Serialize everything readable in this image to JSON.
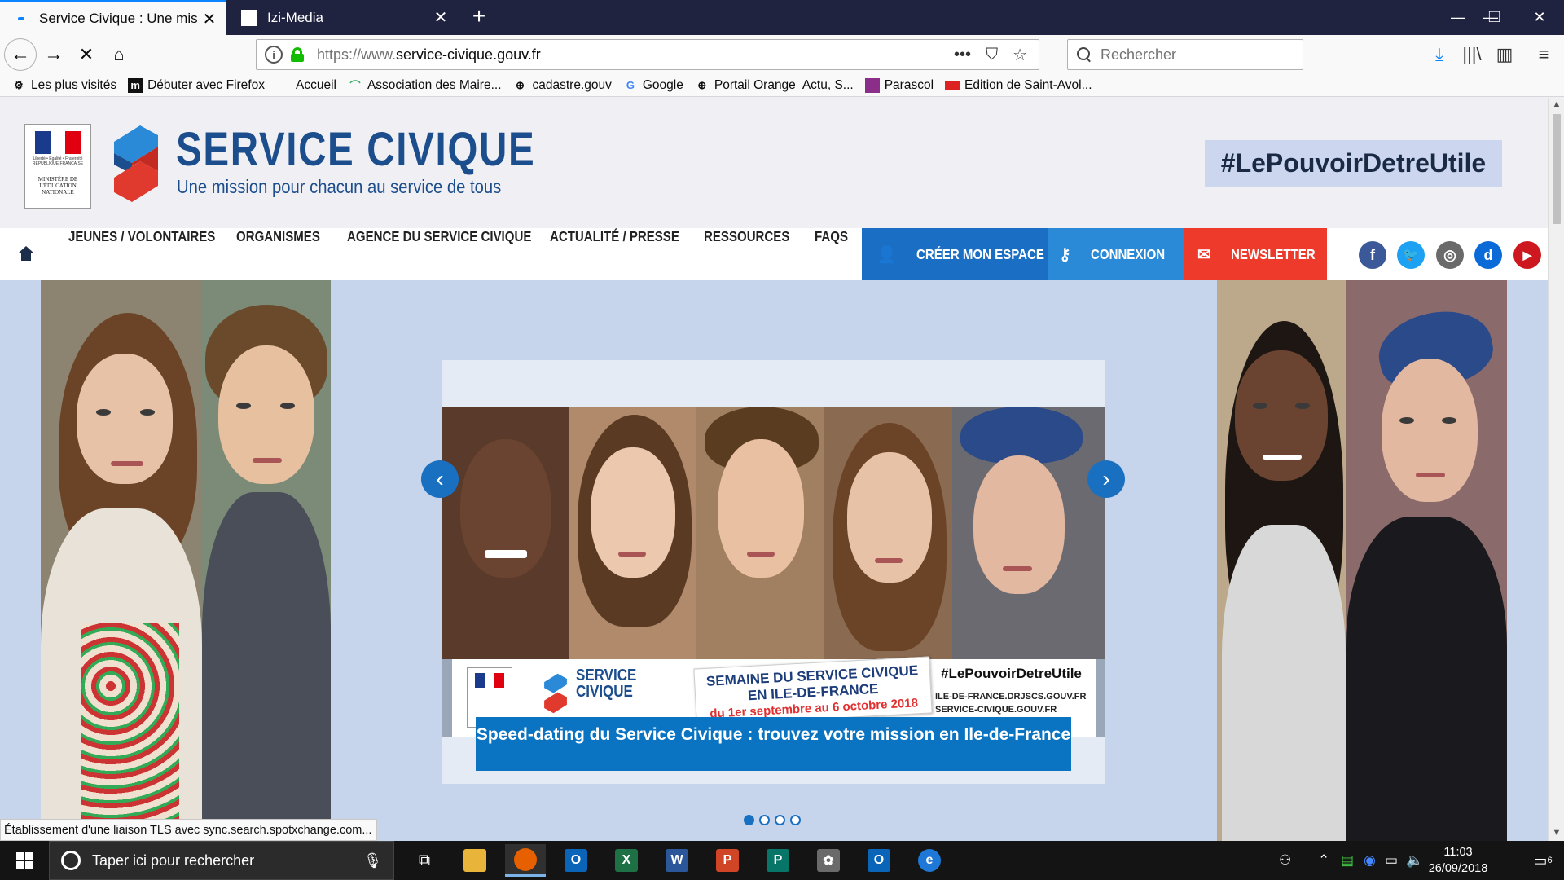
{
  "browser": {
    "tabs": [
      {
        "title": "Service Civique : Une mission p",
        "close": "✕"
      },
      {
        "title": "Izi-Media",
        "close": "✕"
      }
    ],
    "new_tab": "+",
    "window_controls": {
      "minimize": "—",
      "restore": "❐",
      "close": "✕"
    },
    "url": {
      "prefix": "https://www.",
      "domain": "service-civique.gouv.fr"
    },
    "url_actions": {
      "more": "•••",
      "pocket": "⛉",
      "bookmark": "☆"
    },
    "search_placeholder": "Rechercher",
    "bookmarks": [
      {
        "label": "Les plus visités",
        "icon": "gear-icon"
      },
      {
        "label": "Débuter avec Firefox",
        "icon": "m-icon"
      },
      {
        "label": "Accueil",
        "icon": "blank-icon"
      },
      {
        "label": "Association des Maire...",
        "icon": "hat-icon"
      },
      {
        "label": "cadastre.gouv",
        "icon": "globe-icon"
      },
      {
        "label": "Google",
        "icon": "google-icon"
      },
      {
        "label": "Portail Orange",
        "icon": "globe-icon"
      },
      {
        "label": "Actu, S...",
        "icon": "none"
      },
      {
        "label": "Parascol",
        "icon": "parascol-icon"
      },
      {
        "label": "Edition de Saint-Avol...",
        "icon": "edition-icon"
      }
    ]
  },
  "page": {
    "ministere": "MINISTÈRE DE L'ÉDUCATION NATIONALE",
    "republique_motto": "Liberté • Égalité • Fraternité RÉPUBLIQUE FRANÇAISE",
    "title": "SERVICE CIVIQUE",
    "subtitle": "Une mission pour chacun au service de tous",
    "hashtag": "#LePouvoirDetreUtile",
    "menu": [
      "JEUNES / VOLONTAIRES",
      "ORGANISMES",
      "AGENCE DU SERVICE CIVIQUE",
      "ACTUALITÉ / PRESSE",
      "RESSOURCES",
      "FAQS"
    ],
    "buttons": {
      "espace": "CRÉER MON ESPACE",
      "connexion": "CONNEXION",
      "newsletter": "NEWSLETTER"
    },
    "social": [
      {
        "letter": "f",
        "color": "#3b5998",
        "icon": "facebook-icon"
      },
      {
        "letter": "🐦",
        "color": "#1da1f2",
        "icon": "twitter-icon"
      },
      {
        "letter": "◎",
        "color": "#6a6a6a",
        "icon": "instagram-icon"
      },
      {
        "letter": "d",
        "color": "#0a6ad8",
        "icon": "dailymotion-icon"
      },
      {
        "letter": "▶",
        "color": "#cc181e",
        "icon": "youtube-icon"
      }
    ],
    "slider": {
      "banner_title_1": "SEMAINE DU SERVICE CIVIQUE",
      "banner_title_2": "EN ILE-DE-FRANCE",
      "banner_dates": "du 1er septembre au 6 octobre 2018",
      "banner_hashtag": "#LePouvoirDetreUtile",
      "banner_site_1": "ILE-DE-FRANCE.DRJSCS.GOUV.FR",
      "banner_site_2": "SERVICE-CIVIQUE.GOUV.FR",
      "mini_logo_1": "SERVICE",
      "mini_logo_2": "CIVIQUE",
      "caption": "Speed-dating du Service Civique : trouvez votre mission en Ile-de-France",
      "prev": "‹",
      "next": "›",
      "dots": 4,
      "active_dot": 0
    },
    "status_tooltip": "Établissement d'une liaison TLS avec sync.search.spotxchange.com..."
  },
  "taskbar": {
    "search_placeholder": "Taper ici pour rechercher",
    "time": "11:03",
    "date": "26/09/2018",
    "notifications": "6",
    "apps": [
      {
        "name": "task-view",
        "label": "⧉",
        "color": "transparent"
      },
      {
        "name": "file-explorer",
        "label": "📁",
        "color": "#e8b53a"
      },
      {
        "name": "firefox",
        "label": "●",
        "color": "#e66000"
      },
      {
        "name": "outlook",
        "label": "O",
        "color": "#0a64b8"
      },
      {
        "name": "excel",
        "label": "X",
        "color": "#1e7145"
      },
      {
        "name": "word",
        "label": "W",
        "color": "#2b579a"
      },
      {
        "name": "powerpoint",
        "label": "P",
        "color": "#d04525"
      },
      {
        "name": "publisher",
        "label": "P",
        "color": "#077568"
      },
      {
        "name": "paint",
        "label": "✿",
        "color": "#6a6a6a"
      },
      {
        "name": "outlook-mail",
        "label": "O",
        "color": "#0a64b8"
      },
      {
        "name": "edge",
        "label": "e",
        "color": "#1e78d7"
      }
    ]
  },
  "colors": {
    "brand_blue": "#1c4d8c",
    "brand_red": "#e03a2e",
    "connexion_blue": "#2a8ad8",
    "espace_blue": "#1a6fc4",
    "newsletter_red": "#ee3a2a",
    "hero_bg": "#c6d4ec"
  }
}
